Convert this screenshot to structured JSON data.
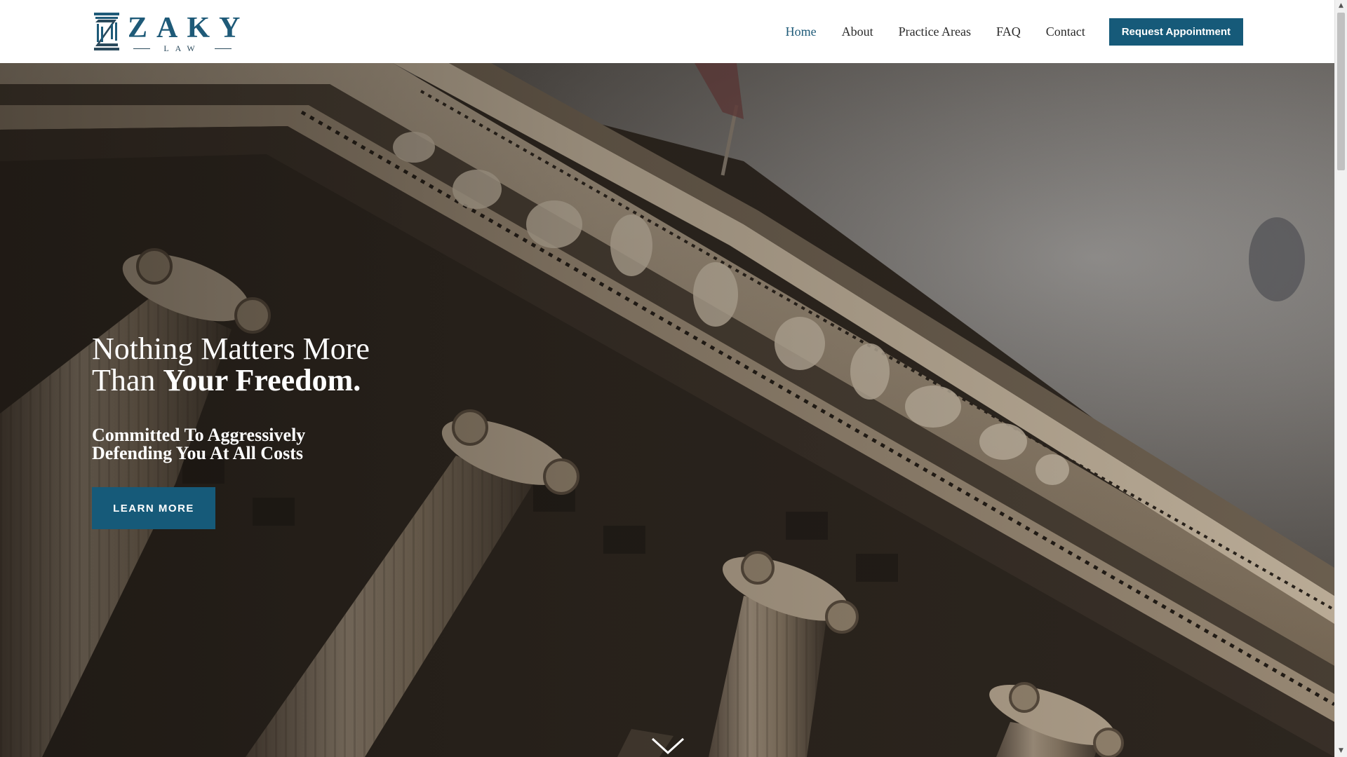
{
  "brand": {
    "name": "ZAKY",
    "subtitle": "LAW",
    "accent_color": "#165a79"
  },
  "nav": {
    "items": [
      {
        "label": "Home",
        "active": true
      },
      {
        "label": "About",
        "active": false
      },
      {
        "label": "Practice Areas",
        "active": false
      },
      {
        "label": "FAQ",
        "active": false
      },
      {
        "label": "Contact",
        "active": false
      }
    ],
    "cta_label": "Request Appointment"
  },
  "hero": {
    "title_line1": "Nothing Matters More",
    "title_line2_plain": "Than ",
    "title_line2_bold": "Your Freedom.",
    "subtitle_line1": "Committed To Aggressively",
    "subtitle_line2": "Defending You At All Costs",
    "button_label": "LEARN MORE",
    "background_icon": "courthouse-columns-photo",
    "scroll_icon": "chevron-down-icon"
  }
}
